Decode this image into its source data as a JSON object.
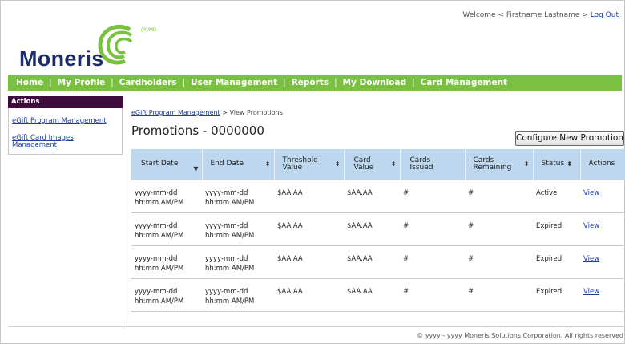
{
  "header": {
    "welcome_prefix": "Welcome < Firstname Lastname >",
    "logout_label": "Log Out"
  },
  "logo": {
    "wordmark": "Moneris",
    "tm": "(R)/MD",
    "colors": {
      "word": "#1f2c6b",
      "swirl": "#7ac142"
    }
  },
  "nav": {
    "items": [
      "Home",
      "My Profile",
      "Cardholders",
      "User Management",
      "Reports",
      "My Download",
      "Card Management"
    ],
    "separator": "|",
    "color": "#7ac142"
  },
  "sidebar": {
    "heading": "Actions",
    "heading_color": "#3d0c3d",
    "links": [
      "eGift Program Management",
      "eGift Card Images Management"
    ]
  },
  "breadcrumb": {
    "link": "eGift Program Management",
    "current": "> View Promotions"
  },
  "page": {
    "title": "Promotions - 0000000",
    "configure_button": "Configure New Promotion"
  },
  "table": {
    "header_color": "#bdd7ee",
    "columns": [
      {
        "label": "Start Date",
        "sort_icon": "sort-down-icon"
      },
      {
        "label": "End Date",
        "sort_icon": "sort-both-icon"
      },
      {
        "label": "Threshold Value",
        "sort_icon": "sort-both-icon"
      },
      {
        "label": "Card Value",
        "sort_icon": "sort-both-icon"
      },
      {
        "label": "Cards Issued",
        "sort_icon": ""
      },
      {
        "label": "Cards Remaining",
        "sort_icon": "sort-both-icon"
      },
      {
        "label": "Status",
        "sort_icon": "sort-both-icon"
      },
      {
        "label": "Actions",
        "sort_icon": ""
      }
    ],
    "rows": [
      {
        "start_date": "yyyy-mm-dd",
        "start_time": "hh:mm AM/PM",
        "end_date": "yyyy-mm-dd",
        "end_time": "hh:mm AM/PM",
        "threshold": "$AA.AA",
        "card_value": "$AA.AA",
        "issued": "#",
        "remaining": "#",
        "status": "Active",
        "action": "View"
      },
      {
        "start_date": "yyyy-mm-dd",
        "start_time": "hh:mm AM/PM",
        "end_date": "yyyy-mm-dd",
        "end_time": "hh:mm AM/PM",
        "threshold": "$AA.AA",
        "card_value": "$AA.AA",
        "issued": "#",
        "remaining": "#",
        "status": "Expired",
        "action": "View"
      },
      {
        "start_date": "yyyy-mm-dd",
        "start_time": "hh:mm AM/PM",
        "end_date": "yyyy-mm-dd",
        "end_time": "hh:mm AM/PM",
        "threshold": "$AA.AA",
        "card_value": "$AA.AA",
        "issued": "#",
        "remaining": "#",
        "status": "Expired",
        "action": "View"
      },
      {
        "start_date": "yyyy-mm-dd",
        "start_time": "hh:mm AM/PM",
        "end_date": "yyyy-mm-dd",
        "end_time": "hh:mm AM/PM",
        "threshold": "$AA.AA",
        "card_value": "$AA.AA",
        "issued": "#",
        "remaining": "#",
        "status": "Expired",
        "action": "View"
      }
    ]
  },
  "footer": {
    "text": "© yyyy - yyyy  Moneris Solutions Corporation. All rights reserved"
  }
}
